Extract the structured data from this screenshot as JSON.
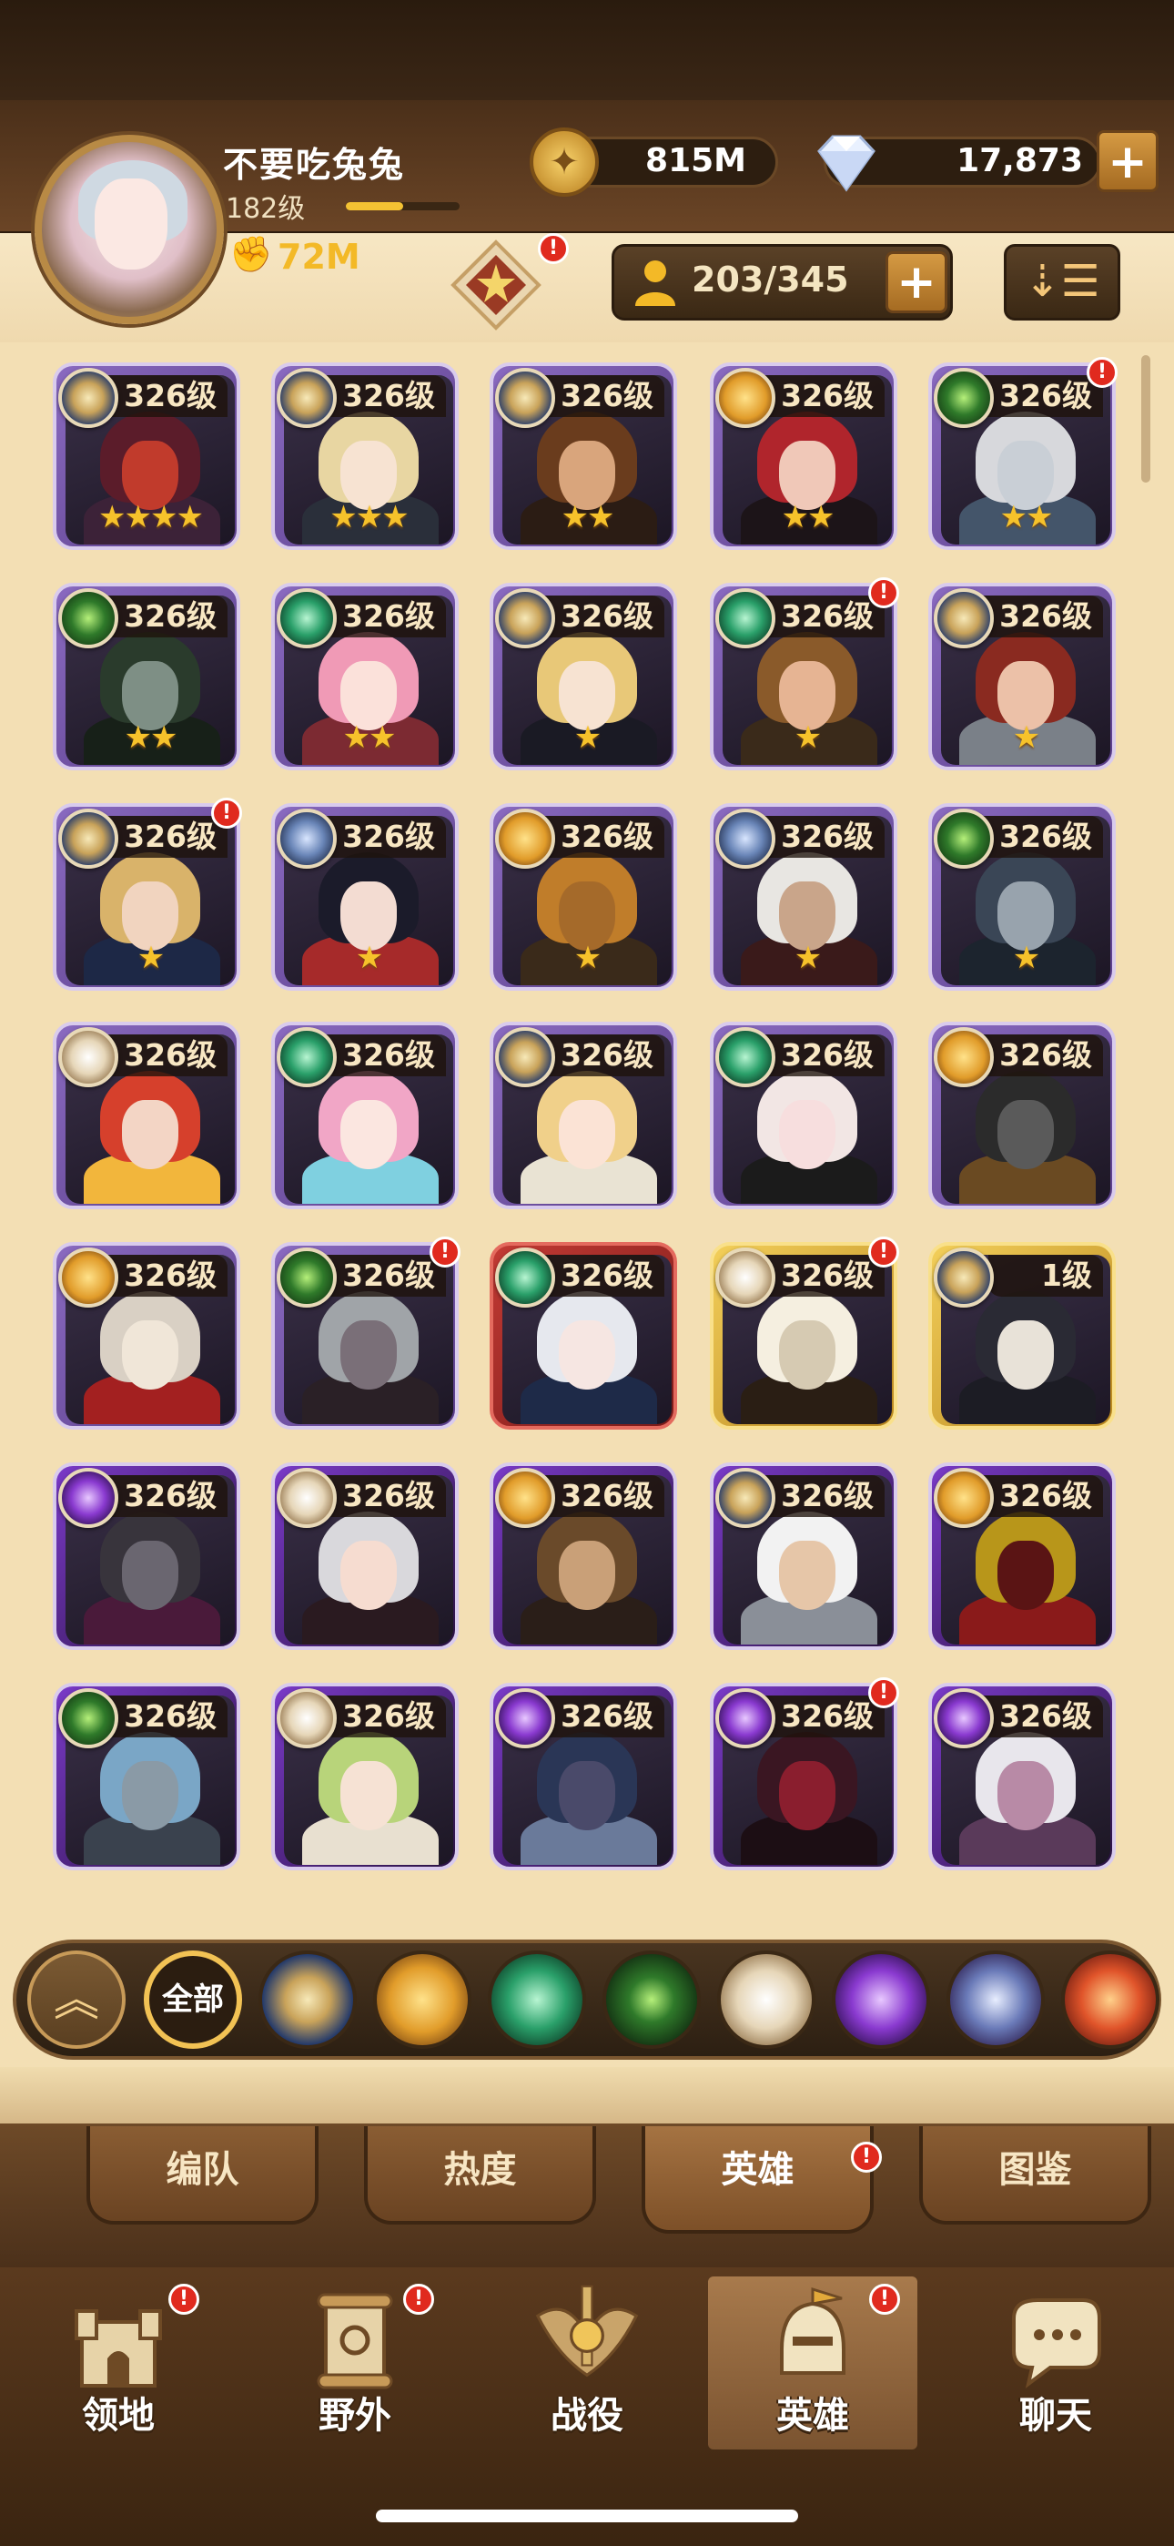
{
  "player": {
    "name": "不要吃兔兔",
    "level": "182级",
    "power": "72M",
    "xp_fraction": 0.5
  },
  "currency": {
    "gold": "815M",
    "gems": "17,873"
  },
  "hero_count": "203/345",
  "colors": {
    "accent": "#f2c254",
    "badge": "#e02a1e",
    "gold_text": "#f3b927",
    "panel": "#f3dfb4"
  },
  "heroes": [
    {
      "level": "326级",
      "faction": "celestial",
      "stars": "★★★★",
      "frame": "purple-star",
      "alert": false,
      "hair": "#5b1c2a",
      "face": "#c13b2c",
      "body": "#3c2238"
    },
    {
      "level": "326级",
      "faction": "celestial",
      "stars": "★★★",
      "frame": "purple-star",
      "alert": false,
      "hair": "#e8d6a2",
      "face": "#f7e3d2",
      "body": "#2a2f3a"
    },
    {
      "level": "326级",
      "faction": "celestial",
      "stars": "★★",
      "frame": "purple-star",
      "alert": false,
      "hair": "#6a3c1d",
      "face": "#d9a57c",
      "body": "#2b1c14"
    },
    {
      "level": "326级",
      "faction": "lightbearer",
      "stars": "★★",
      "frame": "purple-star",
      "alert": false,
      "hair": "#b0252c",
      "face": "#f0c8b8",
      "body": "#1c1418"
    },
    {
      "level": "326级",
      "faction": "wilder",
      "stars": "★★",
      "frame": "purple-star",
      "alert": true,
      "hair": "#d7d8dc",
      "face": "#c9cfd6",
      "body": "#44556a"
    },
    {
      "level": "326级",
      "faction": "wilder",
      "stars": "★★",
      "frame": "purple-star",
      "alert": false,
      "hair": "#2a3b2c",
      "face": "#7e8f85",
      "body": "#172018"
    },
    {
      "level": "326级",
      "faction": "mauler",
      "stars": "★★",
      "frame": "purple-star",
      "alert": false,
      "hair": "#f09ab6",
      "face": "#fbe1da",
      "body": "#7c2a32"
    },
    {
      "level": "326级",
      "faction": "celestial",
      "stars": "★",
      "frame": "purple-star",
      "alert": false,
      "hair": "#e8c878",
      "face": "#f7e3d2",
      "body": "#1a1a24"
    },
    {
      "level": "326级",
      "faction": "mauler",
      "stars": "★",
      "frame": "purple-star",
      "alert": true,
      "hair": "#8a5a2a",
      "face": "#e6b493",
      "body": "#3a2a1a"
    },
    {
      "level": "326级",
      "faction": "celestial",
      "stars": "★",
      "frame": "purple-star",
      "alert": false,
      "hair": "#8a2a20",
      "face": "#ecc1a8",
      "body": "#7a8088"
    },
    {
      "level": "326级",
      "faction": "celestial",
      "stars": "★",
      "frame": "purple-star",
      "alert": true,
      "hair": "#d9b36a",
      "face": "#f1d4bf",
      "body": "#1d2846"
    },
    {
      "level": "326级",
      "faction": "graveborn",
      "stars": "★",
      "frame": "purple-star",
      "alert": false,
      "hair": "#1b1b2a",
      "face": "#f3dcd2",
      "body": "#a62a2a"
    },
    {
      "level": "326级",
      "faction": "lightbearer",
      "stars": "★",
      "frame": "purple-star",
      "alert": false,
      "hair": "#c07d2a",
      "face": "#a56a2a",
      "body": "#3a2a1a"
    },
    {
      "level": "326级",
      "faction": "graveborn",
      "stars": "★",
      "frame": "purple-star",
      "alert": false,
      "hair": "#e8e6e2",
      "face": "#c9a58a",
      "body": "#3a1a1a"
    },
    {
      "level": "326级",
      "faction": "wilder",
      "stars": "★",
      "frame": "purple-star",
      "alert": false,
      "hair": "#3a4656",
      "face": "#98a3ad",
      "body": "#1c242e"
    },
    {
      "level": "326级",
      "faction": "hypogean",
      "stars": "",
      "frame": "purple",
      "alert": false,
      "hair": "#d6402c",
      "face": "#f3d5c5",
      "body": "#f2b63c"
    },
    {
      "level": "326级",
      "faction": "mauler",
      "stars": "",
      "frame": "purple",
      "alert": false,
      "hair": "#f1a6c6",
      "face": "#fbe6e0",
      "body": "#7fd0e0"
    },
    {
      "level": "326级",
      "faction": "celestial",
      "stars": "",
      "frame": "purple",
      "alert": false,
      "hair": "#f0d08a",
      "face": "#fbe3d5",
      "body": "#e9e3d3"
    },
    {
      "level": "326级",
      "faction": "mauler",
      "stars": "",
      "frame": "purple",
      "alert": false,
      "hair": "#f2e6e4",
      "face": "#f7dede",
      "body": "#1b1b1b"
    },
    {
      "level": "326级",
      "faction": "lightbearer",
      "stars": "",
      "frame": "purple",
      "alert": false,
      "hair": "#2b2b2b",
      "face": "#5a5a5a",
      "body": "#6a4a22"
    },
    {
      "level": "326级",
      "faction": "lightbearer",
      "stars": "",
      "frame": "purple",
      "alert": false,
      "hair": "#d9d0c4",
      "face": "#f0e6d8",
      "body": "#a32020"
    },
    {
      "level": "326级",
      "faction": "wilder",
      "stars": "",
      "frame": "purple",
      "alert": true,
      "hair": "#a0a4a8",
      "face": "#7a6f78",
      "body": "#2a2026"
    },
    {
      "level": "326级",
      "faction": "mauler",
      "stars": "",
      "frame": "red",
      "alert": false,
      "hair": "#e6e8ee",
      "face": "#f6e6e2",
      "body": "#1e2a48"
    },
    {
      "level": "326级",
      "faction": "hypogean",
      "stars": "",
      "frame": "gold",
      "alert": true,
      "hair": "#f5efe0",
      "face": "#d6cab2",
      "body": "#2a1e14"
    },
    {
      "level": "1级",
      "faction": "celestial",
      "stars": "",
      "frame": "gold",
      "alert": false,
      "hair": "#2a2a34",
      "face": "#e8e2d8",
      "body": "#1c1c24"
    },
    {
      "level": "326级",
      "faction": "dimensional",
      "stars": "",
      "frame": "dark",
      "alert": false,
      "hair": "#38343c",
      "face": "#6a6670",
      "body": "#4a1a3a"
    },
    {
      "level": "326级",
      "faction": "hypogean",
      "stars": "",
      "frame": "dark",
      "alert": false,
      "hair": "#d9d8dc",
      "face": "#f6dcd0",
      "body": "#2a1a20"
    },
    {
      "level": "326级",
      "faction": "lightbearer",
      "stars": "",
      "frame": "dark",
      "alert": false,
      "hair": "#6a4a2a",
      "face": "#c9a078",
      "body": "#2a1e18"
    },
    {
      "level": "326级",
      "faction": "celestial",
      "stars": "",
      "frame": "dark",
      "alert": false,
      "hair": "#f2f2f2",
      "face": "#e6c6a8",
      "body": "#8a8f98"
    },
    {
      "level": "326级",
      "faction": "lightbearer",
      "stars": "",
      "frame": "dark",
      "alert": false,
      "hair": "#b8961a",
      "face": "#5a1414",
      "body": "#8a1a1a"
    },
    {
      "level": "326级",
      "faction": "wilder",
      "stars": "",
      "frame": "dark",
      "alert": false,
      "hair": "#7aa6c6",
      "face": "#8a9aa6",
      "body": "#3a424e"
    },
    {
      "level": "326级",
      "faction": "hypogean",
      "stars": "",
      "frame": "dark",
      "alert": false,
      "hair": "#b8d47a",
      "face": "#f6e2d4",
      "body": "#e8e0d0"
    },
    {
      "level": "326级",
      "faction": "dimensional",
      "stars": "",
      "frame": "dark",
      "alert": false,
      "hair": "#2a3656",
      "face": "#4a4a6a",
      "body": "#6a7a9a"
    },
    {
      "level": "326级",
      "faction": "dimensional",
      "stars": "",
      "frame": "dark",
      "alert": true,
      "hair": "#3a1622",
      "face": "#8a1e2e",
      "body": "#1c0e14"
    },
    {
      "level": "326级",
      "faction": "dimensional",
      "stars": "",
      "frame": "dark",
      "alert": false,
      "hair": "#e8e6ec",
      "face": "#b88aa6",
      "body": "#5a3a5a"
    }
  ],
  "filters": {
    "all_label": "全部",
    "items": [
      "celestial",
      "lightbearer",
      "wilder",
      "graveborn",
      "hypogean",
      "dimensional",
      "mauler-ring",
      "dragon"
    ]
  },
  "subtabs": [
    "编队",
    "热度",
    "英雄",
    "图鉴"
  ],
  "nav": [
    "领地",
    "野外",
    "战役",
    "英雄",
    "聊天"
  ]
}
